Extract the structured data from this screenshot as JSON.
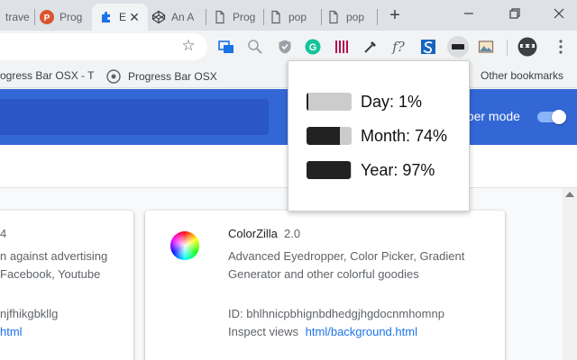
{
  "tabs": [
    {
      "title": "trave",
      "icon": "tab-page-icon"
    },
    {
      "title": "Prog",
      "icon": "product-hunt-icon"
    },
    {
      "title": "E",
      "icon": "extension-puzzle-icon",
      "active": true
    },
    {
      "title": "An A",
      "icon": "codepen-icon"
    },
    {
      "title": "Prog",
      "icon": "document-icon"
    },
    {
      "title": "pop",
      "icon": "document-icon"
    },
    {
      "title": "pop",
      "icon": "document-icon"
    }
  ],
  "new_tab_label": "+",
  "bookmarks": {
    "items": [
      {
        "label": "ogress Bar OSX - T"
      },
      {
        "label": "Progress Bar OSX"
      }
    ],
    "other": "Other bookmarks"
  },
  "page": {
    "developer_mode_label": "oper mode",
    "developer_mode_on": true,
    "cards": [
      {
        "version": "4",
        "desc_line1": "n against advertising",
        "desc_line2": "Facebook, Youtube",
        "id_text": "njfhikgbkllg",
        "inspect_link": "html"
      },
      {
        "name": "ColorZilla",
        "version": "2.0",
        "desc_line1": "Advanced Eyedropper, Color Picker, Gradient",
        "desc_line2": "Generator and other colorful goodies",
        "id_text": "ID: bhlhnicpbhignbdhedgjhgdocnmhomnp",
        "inspect_label": "Inspect views",
        "inspect_link": "html/background.html"
      }
    ]
  },
  "popup": {
    "rows": [
      {
        "label": "Day: 1%",
        "fraction": 0.01
      },
      {
        "label": "Month: 74%",
        "fraction": 0.74
      },
      {
        "label": "Year: 97%",
        "fraction": 0.97
      }
    ]
  },
  "colors": {
    "banner": "#3367d6",
    "link": "#1a73e8",
    "bar_fill": "#222222",
    "bar_track": "#cccccc"
  }
}
